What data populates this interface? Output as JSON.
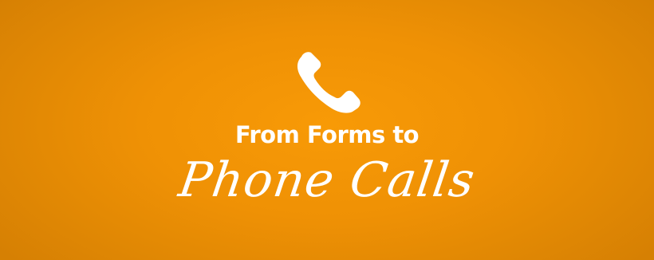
{
  "banner": {
    "icon": "phone-handset-icon",
    "line1": "From Forms to",
    "line2": "Phone Calls",
    "colors": {
      "background": "#f39405",
      "text": "#ffffff"
    }
  }
}
